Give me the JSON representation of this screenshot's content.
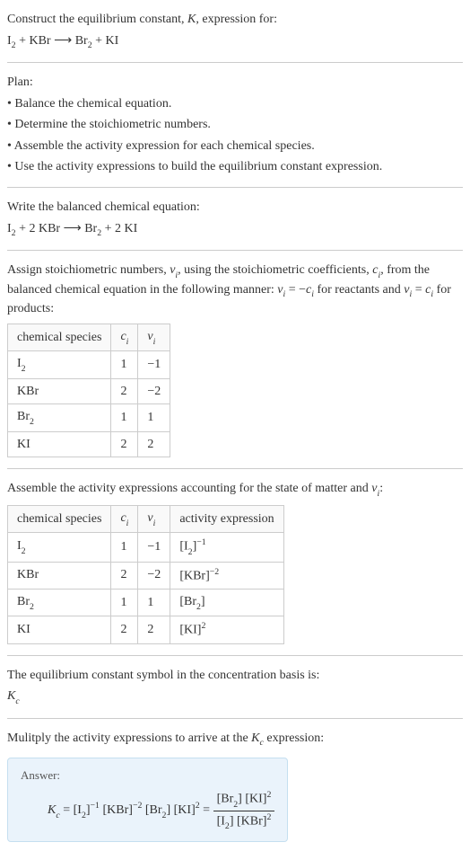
{
  "intro": {
    "line1_pre": "Construct the equilibrium constant, ",
    "line1_K": "K",
    "line1_post": ", expression for:",
    "eq_I2": "I",
    "eq_sub2": "2",
    "eq_plus": " + ",
    "eq_KBr": "KBr",
    "eq_arrow": " ⟶ ",
    "eq_Br": "Br",
    "eq_KI": "KI"
  },
  "plan": {
    "title": "Plan:",
    "b1": "• Balance the chemical equation.",
    "b2": "• Determine the stoichiometric numbers.",
    "b3": "• Assemble the activity expression for each chemical species.",
    "b4": "• Use the activity expressions to build the equilibrium constant expression."
  },
  "balanced": {
    "title": "Write the balanced chemical equation:",
    "two": "2",
    "I": "I",
    "sub2": "2",
    "plus": " + ",
    "KBr": " KBr",
    "arrow": " ⟶ ",
    "Br": "Br",
    "KI": " KI"
  },
  "assign": {
    "p1a": "Assign stoichiometric numbers, ",
    "nu": "ν",
    "i": "i",
    "p1b": ", using the stoichiometric coefficients, ",
    "c": "c",
    "p1c": ", from the balanced chemical equation in the following manner: ",
    "eq1a": " = −",
    "p1d": " for reactants and ",
    "eq2a": " = ",
    "p1e": " for products:"
  },
  "table1": {
    "h1": "chemical species",
    "h2c": "c",
    "h2i": "i",
    "h3n": "ν",
    "h3i": "i",
    "r1_sp_I": "I",
    "r1_sp_2": "2",
    "r1_c": "1",
    "r1_n": "−1",
    "r2_sp": "KBr",
    "r2_c": "2",
    "r2_n": "−2",
    "r3_sp_Br": "Br",
    "r3_sp_2": "2",
    "r3_c": "1",
    "r3_n": "1",
    "r4_sp": "KI",
    "r4_c": "2",
    "r4_n": "2"
  },
  "assemble": {
    "p1a": "Assemble the activity expressions accounting for the state of matter and ",
    "nu": "ν",
    "i": "i",
    "p1b": ":"
  },
  "table2": {
    "h1": "chemical species",
    "h2c": "c",
    "h2i": "i",
    "h3n": "ν",
    "h3i": "i",
    "h4": "activity expression",
    "r1_I": "I",
    "r1_2": "2",
    "r1_c": "1",
    "r1_n": "−1",
    "r1_exp": "−1",
    "r2_sp": "KBr",
    "r2_c": "2",
    "r2_n": "−2",
    "r2_exp": "−2",
    "r3_Br": "Br",
    "r3_2": "2",
    "r3_c": "1",
    "r3_n": "1",
    "r4_sp": "KI",
    "r4_c": "2",
    "r4_n": "2",
    "r4_exp": "2"
  },
  "symbol": {
    "line1": "The equilibrium constant symbol in the concentration basis is:",
    "K": "K",
    "c": "c"
  },
  "multiply": {
    "p1a": "Mulitply the activity expressions to arrive at the ",
    "K": "K",
    "c": "c",
    "p1b": " expression:"
  },
  "answer": {
    "label": "Answer:",
    "K": "K",
    "c": "c",
    "eq": " = ",
    "lb": "[",
    "rb": "]",
    "I": "I",
    "two": "2",
    "negone": "−1",
    "KBr": "KBr",
    "negtwo": "−2",
    "Br": "Br",
    "KI": "KI",
    "sq": "2",
    "eqeq": " = "
  }
}
